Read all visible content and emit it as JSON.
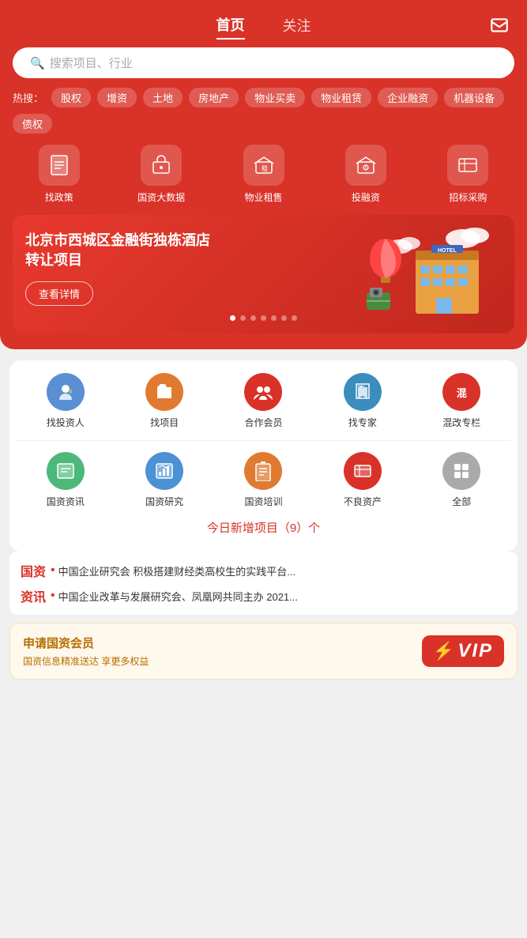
{
  "header": {
    "tab_home": "首页",
    "tab_follow": "关注",
    "msg_icon": "message-icon"
  },
  "search": {
    "placeholder": "搜索项目、行业"
  },
  "hot_search": {
    "label": "热搜：",
    "tags": [
      "股权",
      "增资",
      "土地",
      "房地产",
      "物业买卖",
      "物业租赁",
      "企业融资",
      "机器设备",
      "债权"
    ]
  },
  "nav_icons": [
    {
      "id": "policy",
      "label": "找政策",
      "icon": "📋"
    },
    {
      "id": "data",
      "label": "国资大数据",
      "icon": "🏠"
    },
    {
      "id": "rent",
      "label": "物业租售",
      "icon": "🏷"
    },
    {
      "id": "invest",
      "label": "投融资",
      "icon": "🏛"
    },
    {
      "id": "bid",
      "label": "招标采购",
      "icon": "📦"
    }
  ],
  "banner": {
    "title": "北京市西城区金融街独栋酒店转让项目",
    "btn": "查看详情",
    "dots": 7,
    "active_dot": 0
  },
  "service_icons_row1": [
    {
      "id": "investor",
      "label": "找投资人",
      "color": "#5b8fd4",
      "icon": "👤"
    },
    {
      "id": "project",
      "label": "找项目",
      "color": "#e07a30",
      "icon": "📁"
    },
    {
      "id": "member",
      "label": "合作会员",
      "color": "#d93228",
      "icon": "👥"
    },
    {
      "id": "expert",
      "label": "找专家",
      "color": "#3a8dbd",
      "icon": "🎓"
    },
    {
      "id": "reform",
      "label": "混改专栏",
      "color": "#d93228",
      "icon": "混"
    }
  ],
  "service_icons_row2": [
    {
      "id": "news",
      "label": "国资资讯",
      "color": "#4cb87a",
      "icon": "📰"
    },
    {
      "id": "research",
      "label": "国资研究",
      "color": "#4c91d4",
      "icon": "📊"
    },
    {
      "id": "train",
      "label": "国资培训",
      "color": "#e07a30",
      "icon": "📚"
    },
    {
      "id": "bad_asset",
      "label": "不良资产",
      "color": "#d93228",
      "icon": "🗂"
    },
    {
      "id": "all",
      "label": "全部",
      "color": "#aaaaaa",
      "icon": "⊞"
    }
  ],
  "today_new": "今日新增项目（9）个",
  "news_items": [
    {
      "tag": "国资",
      "tag_color": "red",
      "bullet": "•",
      "text": "中国企业研究会 积极搭建财经类高校生的实践平台..."
    },
    {
      "tag": "资讯",
      "tag_color": "red",
      "bullet": "•",
      "text": "中国企业改革与发展研究会、凤凰网共同主办 2021..."
    }
  ],
  "vip": {
    "title": "申请国资会员",
    "subtitle": "国资信息精准送达 享更多权益",
    "badge": "VIP"
  }
}
